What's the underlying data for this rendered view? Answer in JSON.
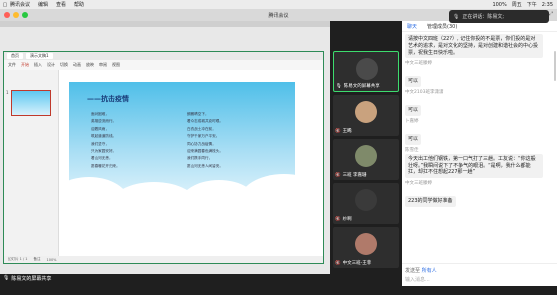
{
  "menubar": {
    "apple": "",
    "items": [
      "腾讯会议",
      "编辑",
      "查看",
      "帮助"
    ],
    "right_status": [
      "100%",
      "周五",
      "下午",
      "2:35"
    ]
  },
  "speak_badge": {
    "label": "正在讲话：陈易文;"
  },
  "window": {
    "title": "腾讯会议"
  },
  "wps": {
    "tabs": [
      "首页",
      "演示文稿1"
    ],
    "toolbar": [
      "文件",
      "开始",
      "插入",
      "设计",
      "切换",
      "动画",
      "放映",
      "审阅",
      "视图"
    ],
    "status": [
      "幻灯片 1 / 1",
      "备注",
      "100%"
    ]
  },
  "slide": {
    "title": "——抗击疫情",
    "poem_left": [
      "面对困难，",
      "英雄逆流而行。",
      "迎着风雨，",
      "筑起道道防线。",
      "我们坚守，",
      "只为家园安好。",
      "看山河无恙，",
      "愿春暖花开归来。"
    ],
    "poem_right": [
      "朗朗晴空下，",
      "看众志成城共克时艰。",
      "白衣战士冲在前，",
      "守护千家万户平安。",
      "同心协力战疫情，",
      "迎来满园春色满枝头。",
      "我们携手同行，",
      "愿山河无恙人间皆安。"
    ]
  },
  "share_label": "陈易文的屏幕共享",
  "tiles": [
    {
      "name": "陈易文的屏幕共享",
      "active": true
    },
    {
      "name": "王睎",
      "active": false
    },
    {
      "name": "三班 李嘉珊",
      "active": false
    },
    {
      "name": "纱啊",
      "active": false
    },
    {
      "name": "中文三班-王菲",
      "active": false
    }
  ],
  "chat": {
    "tabs": [
      "聊天",
      "管理成员(30)"
    ],
    "messages": [
      {
        "sender": "",
        "text": "请按中文四班（22?）, 记住你投的不是票，你们投的是对艺术的追求，是对文化的坚持，是对创建和谐社会的中心投票，祝我生日快乐啦。"
      },
      {
        "sender": "中文三班滕婷",
        "text": "可以"
      },
      {
        "sender": "中文2103班李潇潇",
        "text": "可以"
      },
      {
        "sender": "卜嘉婷",
        "text": "可以"
      },
      {
        "sender": "陈雪佳",
        "text": "今天出工他们钢铁，第一口气打了三趟。工友说：“你这般壮呀。”我瞬间说下了不争气的眼泪。“是啊，我什么都能扛，却扛不住想起227那一趟”"
      },
      {
        "sender": "中文三班滕婷",
        "text": "223的同学做好准备"
      }
    ],
    "send_to_label": "发送至",
    "send_to_value": "所有人",
    "input_placeholder": "输入消息..."
  }
}
